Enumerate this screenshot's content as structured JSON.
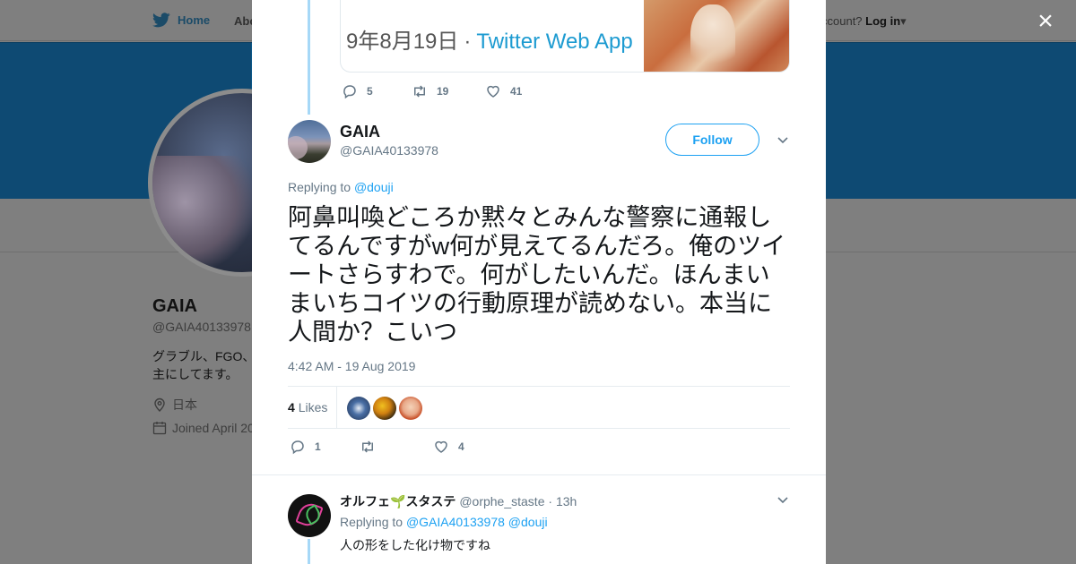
{
  "background": {
    "nav": {
      "home_label": "Home",
      "about_label": "Abo",
      "login_prefix": "ccount?",
      "login_label": "Log in"
    },
    "profile": {
      "name": "GAIA",
      "handle": "@GAIA40133978",
      "bio_line1": "グラブル、FGO、",
      "bio_line2": "主にしてます。",
      "location": "日本",
      "joined": "Joined April 20"
    },
    "close_label": "×"
  },
  "quoted_tweet": {
    "date_text": "9年8月19日",
    "separator": "·",
    "app_text": "Twitter Web App",
    "actions": {
      "replies": "5",
      "retweets": "19",
      "likes": "41"
    }
  },
  "main_tweet": {
    "name": "GAIA",
    "handle": "@GAIA40133978",
    "follow_label": "Follow",
    "replying_prefix": "Replying to",
    "replying_to": "@douji",
    "text": "阿鼻叫喚どころか黙々とみんな警察に通報してるんですがw何が見えてるんだろ。俺のツイートさらすわで。何がしたいんだ。ほんまいまいちコイツの行動原理が読めない。本当に人間か？こいつ",
    "timestamp": "4:42 AM - 19 Aug 2019",
    "likes_count": "4",
    "likes_label": "Likes",
    "actions": {
      "replies": "1",
      "retweets": "",
      "likes": "4"
    }
  },
  "reply": {
    "name": "オルフェ",
    "name_suffix": "スタステ",
    "sprout": "🌱",
    "handle": "@orphe_staste",
    "time": "13h",
    "replying_prefix": "Replying to",
    "replying_to_1": "@GAIA40133978",
    "replying_to_2": "@douji",
    "text": "人の形をした化け物ですね"
  }
}
